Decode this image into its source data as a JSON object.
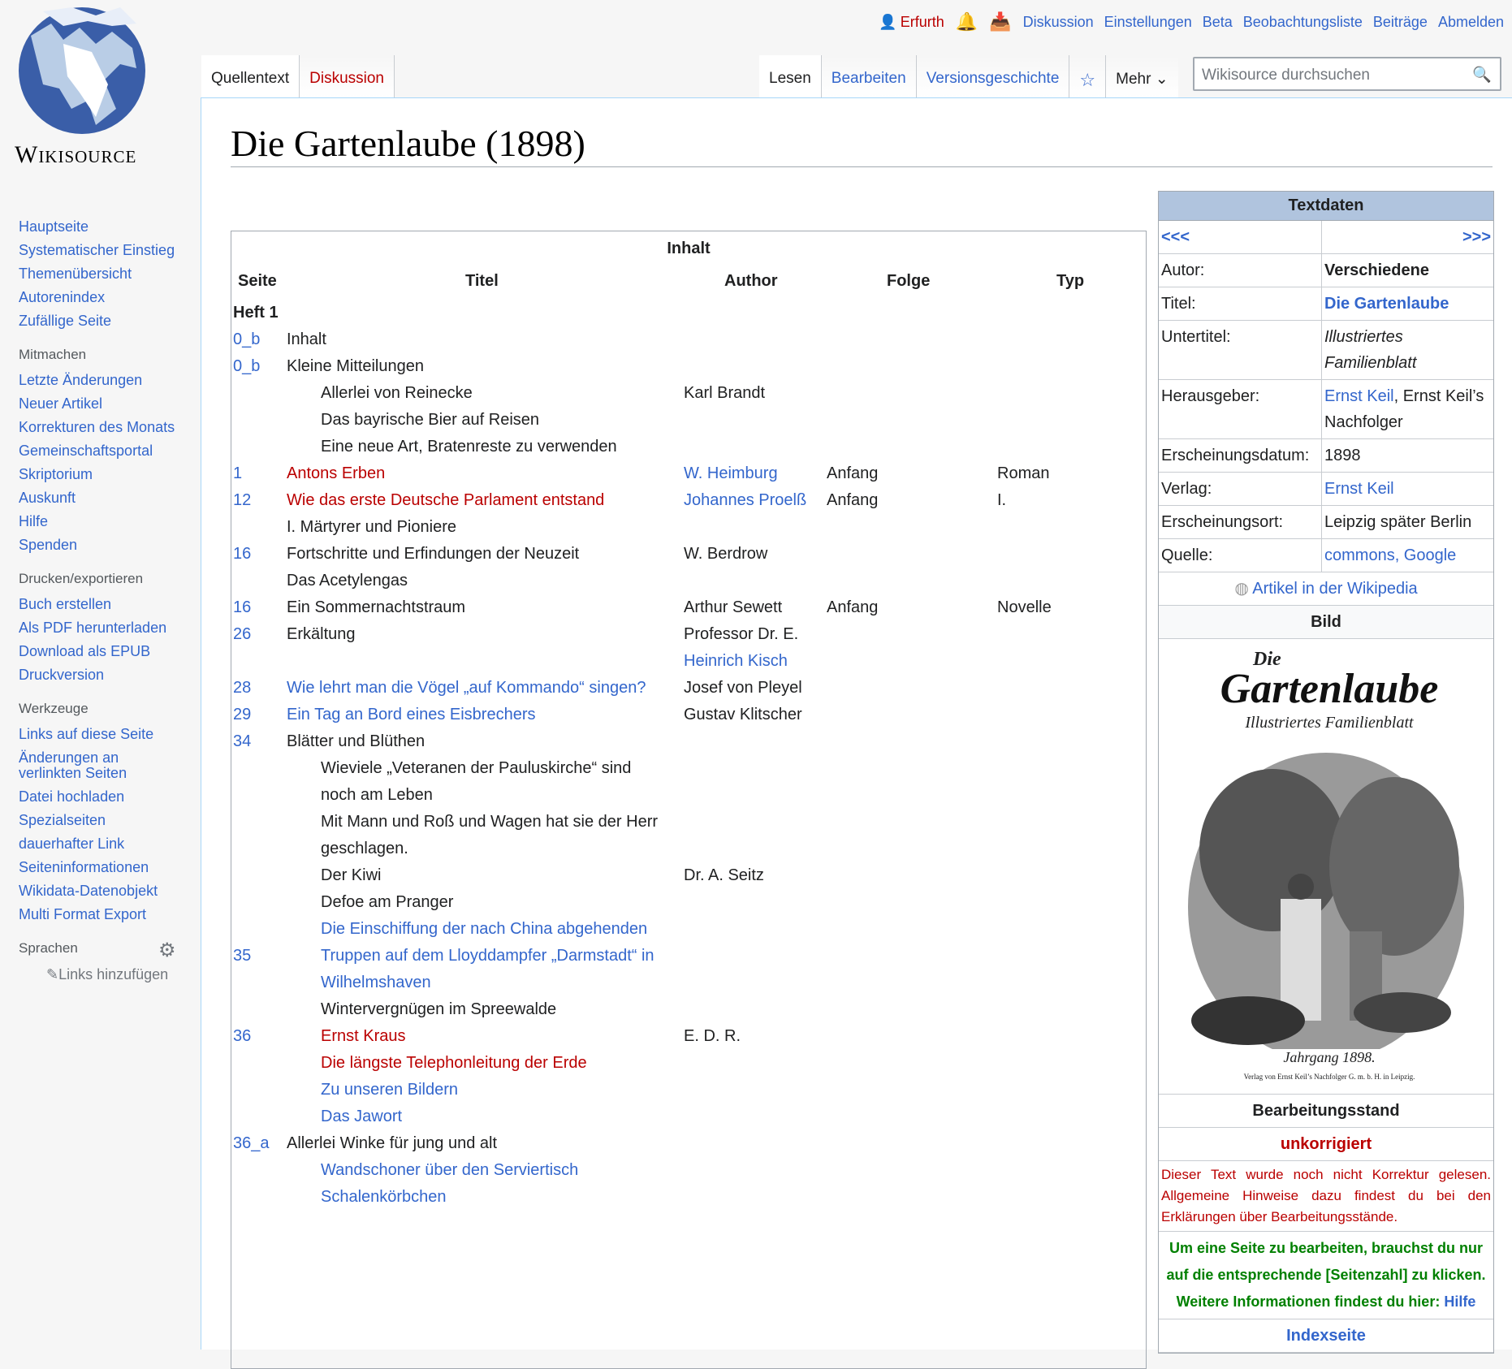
{
  "logo": {
    "wordmark": "Wikisource"
  },
  "personal": {
    "user": "Erfurth",
    "links": [
      "Diskussion",
      "Einstellungen",
      "Beta",
      "Beobachtungsliste",
      "Beiträge",
      "Abmelden"
    ]
  },
  "tabs": {
    "namespace": [
      "Quellentext",
      "Diskussion"
    ],
    "views": [
      "Lesen",
      "Bearbeiten",
      "Versionsgeschichte"
    ],
    "more": "Mehr"
  },
  "search": {
    "placeholder": "Wikisource durchsuchen"
  },
  "sidebar": {
    "nav": [
      "Hauptseite",
      "Systematischer Einstieg",
      "Themenübersicht",
      "Autorenindex",
      "Zufällige Seite"
    ],
    "mitmachen": {
      "title": "Mitmachen",
      "items": [
        "Letzte Änderungen",
        "Neuer Artikel",
        "Korrekturen des Monats",
        "Gemeinschaftsportal",
        "Skriptorium",
        "Auskunft",
        "Hilfe",
        "Spenden"
      ]
    },
    "drucken": {
      "title": "Drucken/exportieren",
      "items": [
        "Buch erstellen",
        "Als PDF herunterladen",
        "Download als EPUB",
        "Druckversion"
      ]
    },
    "werkzeuge": {
      "title": "Werkzeuge",
      "items": [
        "Links auf diese Seite",
        "Änderungen an verlinkten Seiten",
        "Datei hochladen",
        "Spezialseiten",
        "dauerhafter Link",
        "Seiteninformationen",
        "Wikidata-Datenobjekt",
        "Multi Format Export"
      ]
    },
    "sprachen": {
      "title": "Sprachen",
      "add": "Links hinzufügen"
    }
  },
  "page_title": "Die Gartenlaube (1898)",
  "toc": {
    "caption": "Inhalt",
    "headers": [
      "Seite",
      "Titel",
      "Author",
      "Folge",
      "Typ"
    ],
    "heft": "Heft 1",
    "rows": [
      {
        "s": "0_b",
        "t": "Inhalt",
        "a": "",
        "f": "",
        "y": ""
      },
      {
        "s": "0_b",
        "t": "Kleine Mitteilungen",
        "a": "",
        "f": "",
        "y": ""
      },
      {
        "s": "",
        "t": "Allerlei von Reinecke",
        "a": "Karl Brandt",
        "f": "",
        "y": ""
      },
      {
        "s": "",
        "t": "Das bayrische Bier auf Reisen",
        "a": "",
        "f": "",
        "y": ""
      },
      {
        "s": "",
        "t": "Eine neue Art, Bratenreste zu verwenden",
        "a": "",
        "f": "",
        "y": ""
      },
      {
        "s": "1",
        "t": "Antons Erben",
        "a": "W. Heimburg",
        "f": "Anfang",
        "y": "Roman"
      },
      {
        "s": "12",
        "t": "Wie das erste Deutsche Parlament entstand",
        "t2": "I. Märtyrer und Pioniere",
        "a": "Johannes Proelß",
        "f": "Anfang",
        "y": "I."
      },
      {
        "s": "16",
        "t": "Fortschritte und Erfindungen der Neuzeit",
        "t2": "Das Acetylengas",
        "a": "W. Berdrow",
        "f": "",
        "y": ""
      },
      {
        "s": "16",
        "t": "Ein Sommernachtstraum",
        "a": "Arthur Sewett",
        "f": "Anfang",
        "y": "Novelle"
      },
      {
        "s": "26",
        "t": "Erkältung",
        "a": "Professor Dr. E.",
        "a2": "Heinrich Kisch",
        "f": "",
        "y": ""
      },
      {
        "s": "28",
        "t": "Wie lehrt man die Vögel „auf Kommando“ singen?",
        "a": "Josef von Pleyel",
        "f": "",
        "y": ""
      },
      {
        "s": "29",
        "t": "Ein Tag an Bord eines Eisbrechers",
        "a": "Gustav Klitscher",
        "f": "",
        "y": ""
      },
      {
        "s": "34",
        "t": "Blätter und Blüthen",
        "a": "",
        "f": "",
        "y": ""
      },
      {
        "s": "",
        "t": "Wieviele „Veteranen der Pauluskirche“ sind",
        "t2": "noch am Leben",
        "a": "",
        "f": "",
        "y": ""
      },
      {
        "s": "",
        "t": "Mit Mann und Roß und Wagen hat sie der Herr",
        "t2": "geschlagen.",
        "a": "",
        "f": "",
        "y": ""
      },
      {
        "s": "",
        "t": "Der Kiwi",
        "a": "Dr. A. Seitz",
        "f": "",
        "y": ""
      },
      {
        "s": "",
        "t": "Defoe am Pranger",
        "a": "",
        "f": "",
        "y": ""
      },
      {
        "s": "35",
        "t": "Die Einschiffung der nach China abgehenden",
        "t2": "Truppen auf dem Lloyddampfer „Darmstadt“ in",
        "t3": "Wilhelmshaven",
        "a": "",
        "f": "",
        "y": ""
      },
      {
        "s": "",
        "t": "Wintervergnügen im Spreewalde",
        "a": "",
        "f": "",
        "y": ""
      },
      {
        "s": "36",
        "t": "Ernst Kraus",
        "a": "E. D. R.",
        "f": "",
        "y": ""
      },
      {
        "s": "",
        "t": "Die längste Telephonleitung der Erde",
        "a": "",
        "f": "",
        "y": ""
      },
      {
        "s": "",
        "t": "Zu unseren Bildern",
        "a": "",
        "f": "",
        "y": ""
      },
      {
        "s": "",
        "t": "Das Jawort",
        "a": "",
        "f": "",
        "y": ""
      },
      {
        "s": "36_a",
        "t": "Allerlei Winke für jung und alt",
        "a": "",
        "f": "",
        "y": ""
      },
      {
        "s": "",
        "t": "Wandschoner über den Serviertisch",
        "a": "",
        "f": "",
        "y": ""
      },
      {
        "s": "",
        "t": "Schalenkörbchen",
        "a": "",
        "f": "",
        "y": ""
      }
    ]
  },
  "infobox": {
    "title": "Textdaten",
    "prev": "<<<",
    "next": ">>>",
    "fields": [
      {
        "label": "Autor:",
        "value": "Verschiedene"
      },
      {
        "label": "Titel:",
        "value": "Die Gartenlaube"
      },
      {
        "label": "Untertitel:",
        "value": "Illustriertes Familienblatt"
      },
      {
        "label": "Herausgeber:",
        "value": "Ernst Keil",
        "value2": ", Ernst Keil’s Nachfolger"
      },
      {
        "label": "Erscheinungsdatum:",
        "value": "1898"
      },
      {
        "label": "Verlag:",
        "value": "Ernst Keil"
      },
      {
        "label": "Erscheinungsort:",
        "value": "Leipzig später Berlin"
      },
      {
        "label": "Quelle:",
        "value": "commons, Google"
      }
    ],
    "wikipedia": "Artikel in der Wikipedia",
    "bild": "Bild",
    "cover": {
      "line1": "Die",
      "line2": "Gartenlaube",
      "line3": "Illustriertes Familienblatt",
      "line4": "Jahrgang 1898.",
      "line5": "Verlag von Ernst Keil’s Nachfolger G. m. b. H. in Leipzig."
    },
    "status_title": "Bearbeitungsstand",
    "status": "unkorrigiert",
    "status_note": "Dieser Text wurde noch nicht Korrektur gelesen. Allgemeine Hinweise dazu findest du bei den Erklärungen über Bearbeitungsstände.",
    "help_line1": "Um eine Seite zu bearbeiten, brauchst du nur",
    "help_line2": "auf die entsprechende [Seitenzahl] zu klicken.",
    "help_line3": "Weitere Informationen findest du hier:",
    "help_link": "Hilfe",
    "indexseite": "Indexseite"
  }
}
